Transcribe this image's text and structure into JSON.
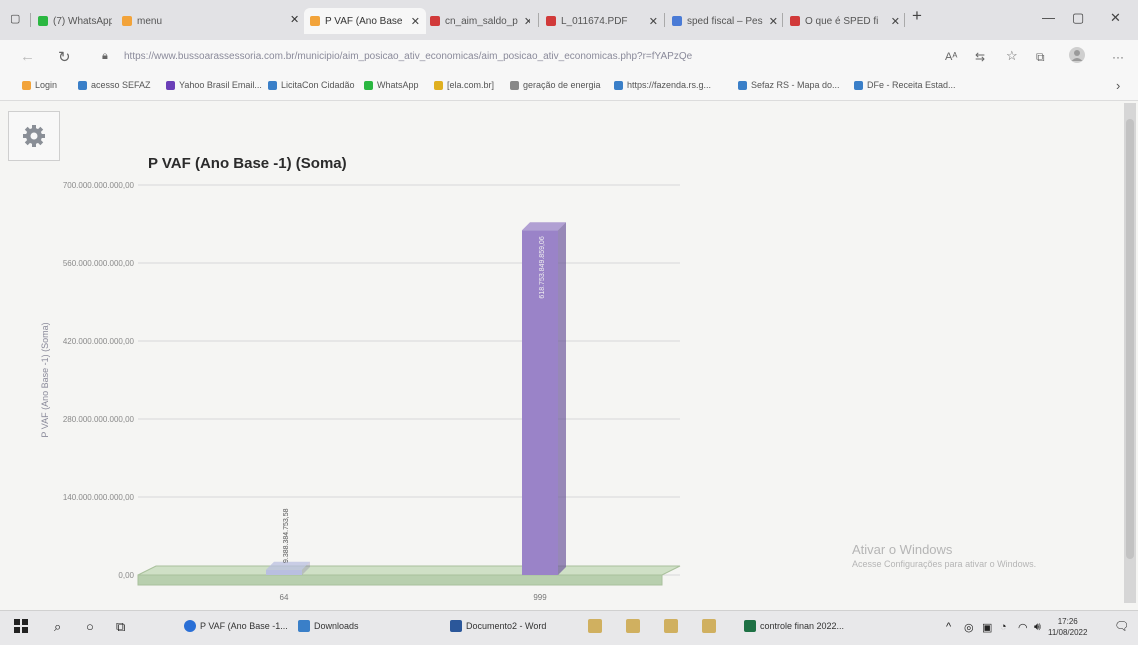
{
  "browser": {
    "tabs": [
      {
        "label": "(7) WhatsApp",
        "color": "#2bb741"
      },
      {
        "label": "menu",
        "color": "#f2a33a"
      },
      {
        "label": "P VAF (Ano Base",
        "color": "#f2a33a"
      },
      {
        "label": "cn_aim_saldo_p",
        "color": "#d13a3a"
      },
      {
        "label": "L_011674.PDF",
        "color": "#d13a3a"
      },
      {
        "label": "sped fiscal – Pes",
        "color": "#4a7bd6"
      },
      {
        "label": "O que é SPED fi",
        "color": "#d13a3a"
      }
    ],
    "new_tab": "+",
    "url_host": "https://www.bussoarassessoria.com.br",
    "url_path": "/municipio/aim_posicao_ativ_economicas/aim_posicao_ativ_economicas.php?r=fYAPzQe",
    "bookmarks": [
      {
        "label": "Login",
        "color": "#f2a33a"
      },
      {
        "label": "acesso SEFAZ",
        "color": "#3a7fc8"
      },
      {
        "label": "Yahoo Brasil Email...",
        "color": "#6b3fb8"
      },
      {
        "label": "LicitaCon Cidadão",
        "color": "#3a7fc8"
      },
      {
        "label": "WhatsApp",
        "color": "#2bb741"
      },
      {
        "label": "[ela.com.br]",
        "color": "#e0b020"
      },
      {
        "label": "geração de energia",
        "color": "#888888"
      },
      {
        "label": "https://fazenda.rs.g...",
        "color": "#3a7fc8"
      },
      {
        "label": "Sefaz RS - Mapa do...",
        "color": "#3a7fc8"
      },
      {
        "label": "DFe - Receita Estad...",
        "color": "#3a7fc8"
      }
    ]
  },
  "chart_data": {
    "type": "bar",
    "title": "P VAF (Ano Base -1) (Soma)",
    "ylabel": "P VAF (Ano Base -1) (Soma)",
    "xlabel": "",
    "categories": [
      "64",
      "999"
    ],
    "values": [
      9388384753.58,
      618753849859.06
    ],
    "value_labels": [
      "9.388.384.753,58",
      "618.753.849.859,06"
    ],
    "ylim": [
      0,
      700000000000
    ],
    "yticks": [
      0,
      140000000000,
      280000000000,
      420000000000,
      560000000000,
      700000000000
    ],
    "ytick_labels": [
      "0,00",
      "140.000.000.000,00",
      "280.000.000.000,00",
      "420.000.000.000,00",
      "560.000.000.000,00",
      "700.000.000.000,00"
    ],
    "bar_colors": [
      "#b9bfe0",
      "#9a83c8"
    ],
    "grid": true
  },
  "watermark": {
    "title": "Ativar o Windows",
    "subtitle": "Acesse Configurações para ativar o Windows."
  },
  "taskbar": {
    "apps": [
      {
        "label": "P VAF (Ano Base -1...",
        "color": "#2a6fd6"
      },
      {
        "label": "Downloads",
        "color": "#3a7fc8"
      },
      {
        "label": "Documento2 - Word",
        "color": "#2b579a"
      },
      {
        "label": "controle finan 2022...",
        "color": "#1e7145"
      }
    ],
    "time": "17:26",
    "date": "11/08/2022"
  }
}
